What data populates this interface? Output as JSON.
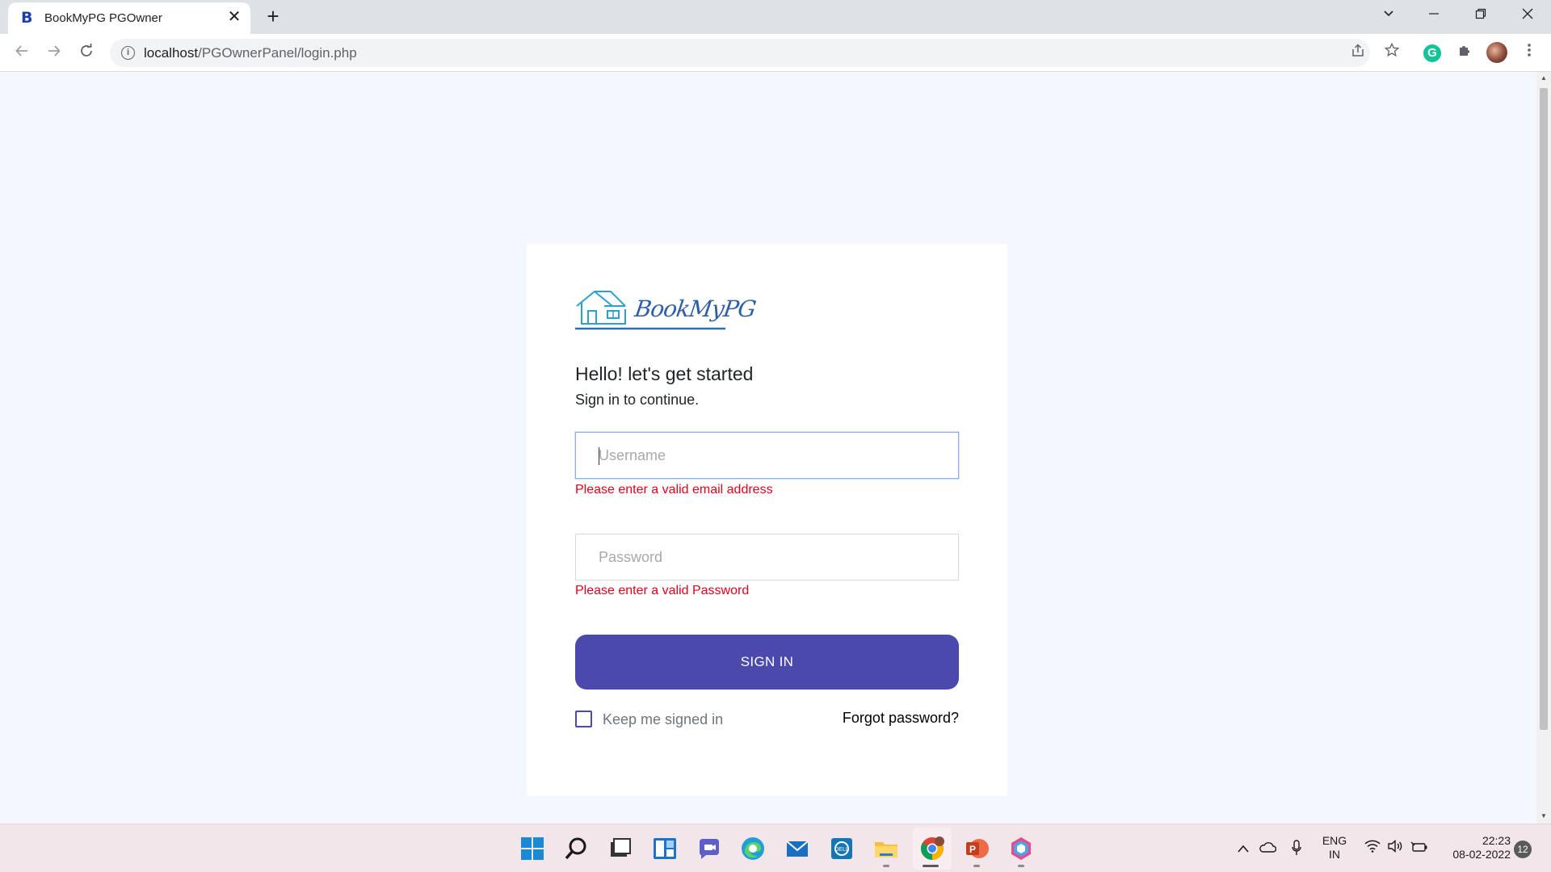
{
  "browser": {
    "tab_title": "BookMyPG PGOwner",
    "tab_favicon": "B",
    "url_host": "localhost",
    "url_path": "/PGOwnerPanel/login.php"
  },
  "page": {
    "logo_text": "BookMyPG",
    "heading": "Hello! let's get started",
    "subheading": "Sign in to continue.",
    "username_placeholder": "Username",
    "username_error": "Please enter a valid email address",
    "password_placeholder": "Password",
    "password_error": "Please enter a valid Password",
    "signin_label": "SIGN IN",
    "keep_signed_label": "Keep me signed in",
    "forgot_label": "Forgot password?"
  },
  "taskbar": {
    "lang_line1": "ENG",
    "lang_line2": "IN",
    "time": "22:23",
    "date": "08-02-2022",
    "notification_count": "12"
  },
  "colors": {
    "primary": "#4b49ac",
    "error": "#e3001b",
    "page_bg": "#f4f7fe"
  }
}
